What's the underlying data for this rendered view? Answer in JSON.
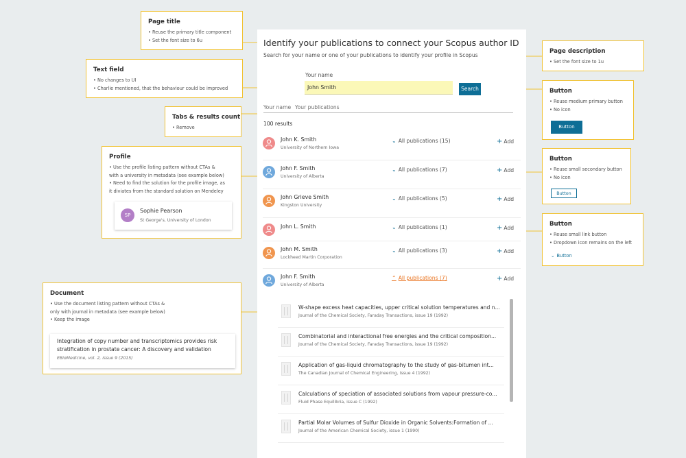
{
  "colors": {
    "accent": "#f1c232",
    "primary": "#0e6e96",
    "active_link": "#e9711c",
    "field_highlight": "#fbf8b8"
  },
  "page": {
    "title": "Identify your publications to connect your Scopus author ID",
    "description": "Search for your name or one of your publications to identify your profile in Scopus",
    "search": {
      "label": "Your name",
      "value": "John Smith",
      "button": "Search"
    },
    "tabs": [
      "Your name",
      "Your publications"
    ],
    "results_count": "100 results",
    "profiles": [
      {
        "name": "John K. Smith",
        "affiliation": "University of Northern Iowa",
        "publications": "All publications (15)",
        "add": "Add",
        "avatar_color": "#ef8a8a",
        "icon": "user-icon"
      },
      {
        "name": "John F. Smith",
        "affiliation": "University of Alberta",
        "publications": "All publications (7)",
        "add": "Add",
        "avatar_color": "#6fa8dc",
        "icon": "user-icon"
      },
      {
        "name": "John Grieve Smith",
        "affiliation": "Kingston University",
        "publications": "All publications (5)",
        "add": "Add",
        "avatar_color": "#f0954e",
        "icon": "user-icon"
      },
      {
        "name": "John L. Smith",
        "affiliation": "",
        "publications": "All publications (1)",
        "add": "Add",
        "avatar_color": "#ef8a8a",
        "icon": "user-icon"
      },
      {
        "name": "John M. Smith",
        "affiliation": "Lockheed Martin Corporation",
        "publications": "All publications (3)",
        "add": "Add",
        "avatar_color": "#f0954e",
        "icon": "user-icon"
      },
      {
        "name": "John F. Smith",
        "affiliation": "University of Alberta",
        "publications": "All publications (7)",
        "add": "Add",
        "avatar_color": "#6fa8dc",
        "icon": "user-icon",
        "expanded": true
      }
    ],
    "documents": [
      {
        "title": "W-shape excess heat capacities, upper critical solution temperatures and n...",
        "source": "Journal of the Chemical Society, Faraday Transactions, issue 19 (1992)"
      },
      {
        "title": "Combinatorial and interactional free energies and the critical composition...",
        "source": "Journal of the Chemical Society, Faraday Transactions, issue 19 (1992)"
      },
      {
        "title": "Application of gas-liquid chromatography to the study of gas-bitumen int...",
        "source": "The Canadian Journal of Chemical Engineering, issue 4 (1992)"
      },
      {
        "title": "Calculations of speciation of associated solutions from vapour pressure-co...",
        "source": "Fluid Phase Equilibria, issue C (1992)"
      },
      {
        "title": "Partial Molar Volumes of Sulfur Dioxide in Organic Solvents:Formation of ...",
        "source": "Journal of the American Chemical Society, issue 1 (1990)"
      }
    ]
  },
  "annotations": {
    "page_title": {
      "title": "Page title",
      "items": [
        "• Reuse the primary title component",
        "• Set the font size to 6u"
      ]
    },
    "text_field": {
      "title": "Text field",
      "items": [
        "• No changes to UI",
        "• Charlie mentioned, that the behaviour could be improved"
      ]
    },
    "tabs_count": {
      "title": "Tabs & results count",
      "items": [
        "• Remove"
      ]
    },
    "profile": {
      "title": "Profile",
      "items": [
        "• Use the profile listing pattern without CTAs &",
        "  with a university in metadata (see example below)",
        "• Need to find the solution for the profile image, as",
        "  it diviates from the standard solution on Mendeley"
      ],
      "example": {
        "initials": "SP",
        "name": "Sophie Pearson",
        "affiliation": "St George's, University of London"
      }
    },
    "document": {
      "title": "Document",
      "items": [
        "• Use the document listing pattern without CTAs &",
        "  only with journal in metadata (see example below)",
        "• Keep the image"
      ],
      "example": {
        "title_line1": "Integration of copy number and transcriptomics provides risk",
        "title_line2": "stratification in prostate cancer: A discovery and validation",
        "source": "EBioMedicine, vol. 2, issue 9 (2015)"
      }
    },
    "page_description": {
      "title": "Page description",
      "items": [
        "• Set the font size to 1u"
      ]
    },
    "button_primary": {
      "title": "Button",
      "items": [
        "• Reuse medium primary button",
        "• No icon"
      ],
      "example_label": "Button"
    },
    "button_secondary": {
      "title": "Button",
      "items": [
        "• Reuse small secondary button",
        "• No icon"
      ],
      "example_label": "Button"
    },
    "button_link": {
      "title": "Button",
      "items": [
        "• Reuse small link button",
        "• Dropdown icon remains on the left"
      ],
      "example_label": "Button"
    }
  }
}
